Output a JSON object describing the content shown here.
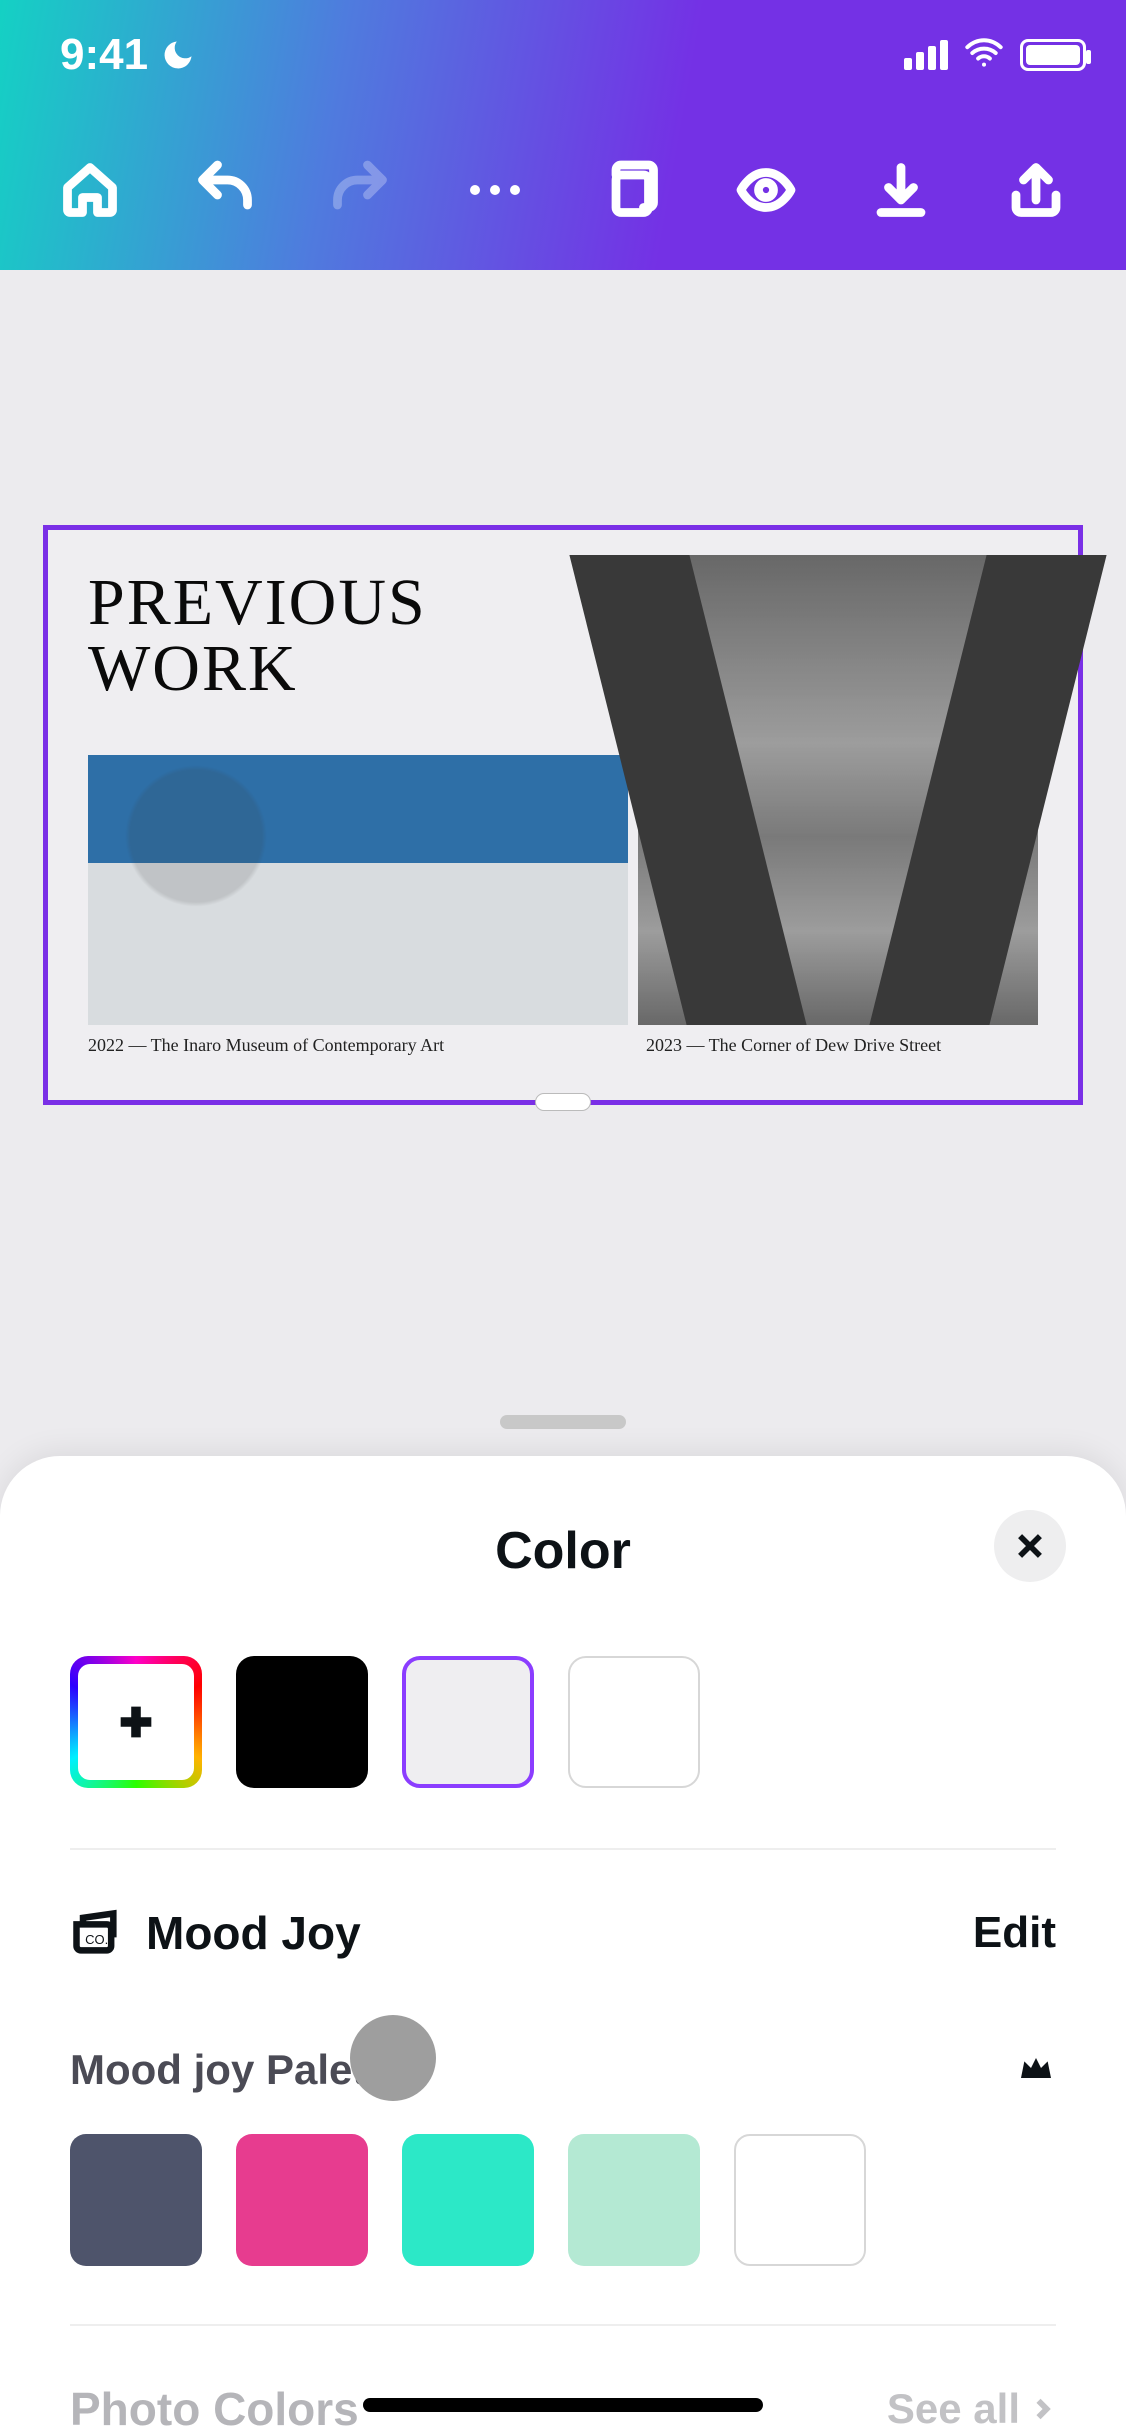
{
  "status": {
    "time": "9:41"
  },
  "design": {
    "title_line1": "PREVIOUS",
    "title_line2": "WORK",
    "caption_left": "2022 — The Inaro Museum of Contemporary Art",
    "caption_right": "2023 — The Corner of Dew Drive Street"
  },
  "sheet": {
    "title": "Color",
    "document_colors": [
      {
        "role": "add",
        "hex": null
      },
      {
        "role": "black",
        "hex": "#000000"
      },
      {
        "role": "selected",
        "hex": "#EFEEF1"
      },
      {
        "role": "white",
        "hex": "#FFFFFF"
      }
    ],
    "brand": {
      "name": "Mood Joy",
      "edit_label": "Edit",
      "palette_name": "Mood joy Palette",
      "palette": [
        {
          "hex": "#4E546B"
        },
        {
          "hex": "#E73C8F"
        },
        {
          "hex": "#2CE8C7"
        },
        {
          "hex": "#B4E9D3"
        },
        {
          "hex": "#FFFFFF"
        }
      ]
    },
    "photo_colors": {
      "label": "Photo Colors",
      "see_all": "See all"
    }
  }
}
